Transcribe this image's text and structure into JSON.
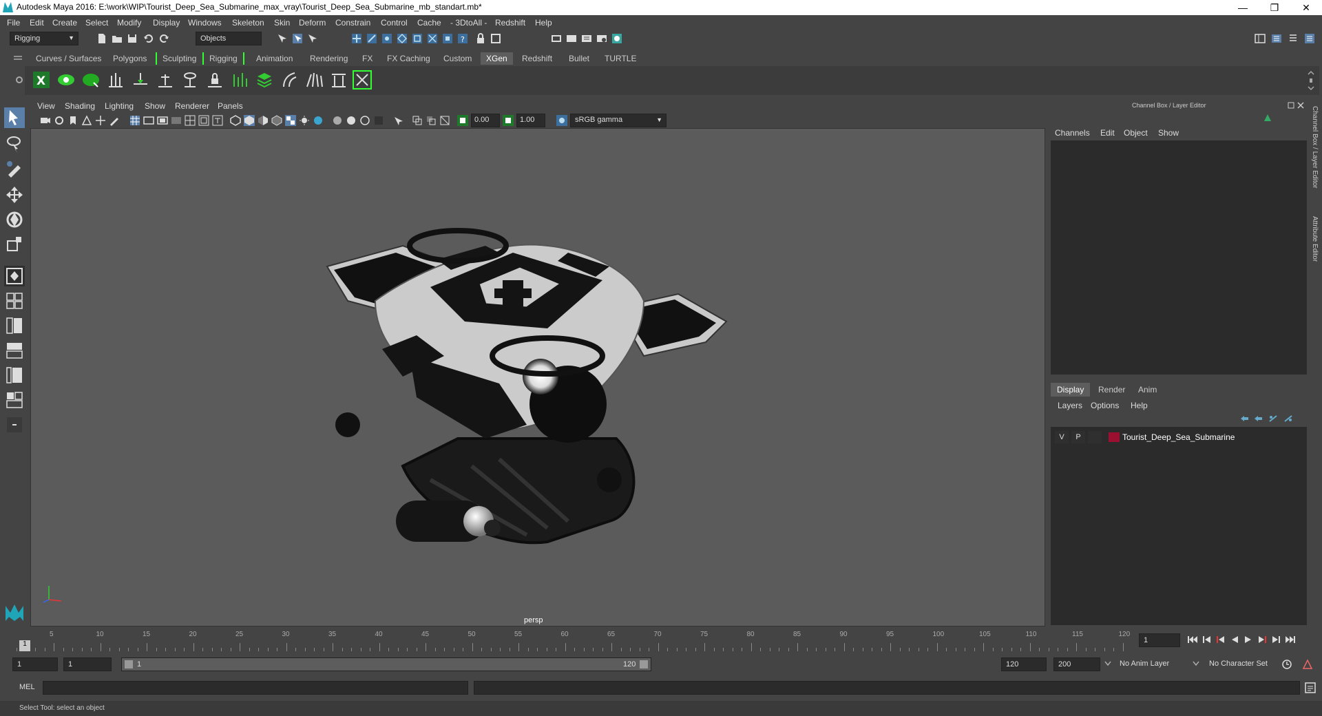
{
  "window": {
    "title": "Autodesk Maya 2016: E:\\work\\WIP\\Tourist_Deep_Sea_Submarine_max_vray\\Tourist_Deep_Sea_Submarine_mb_standart.mb*",
    "minimize": "—",
    "restore": "❐",
    "close": "✕"
  },
  "menubar": [
    "File",
    "Edit",
    "Create",
    "Select",
    "Modify",
    "Display",
    "Windows",
    "Skeleton",
    "Skin",
    "Deform",
    "Constrain",
    "Control",
    "Cache",
    "- 3DtoAll -",
    "Redshift",
    "Help"
  ],
  "toolbar": {
    "mode": "Rigging",
    "selection_mask": "Objects"
  },
  "shelf_tabs": {
    "items": [
      "Curves / Surfaces",
      "Polygons",
      "Sculpting",
      "Rigging",
      "Animation",
      "Rendering",
      "FX",
      "FX Caching",
      "Custom",
      "XGen",
      "Redshift",
      "Bullet",
      "TURTLE"
    ],
    "active": "XGen"
  },
  "viewport": {
    "menu": [
      "View",
      "Shading",
      "Lighting",
      "Show",
      "Renderer",
      "Panels"
    ],
    "exposure": "0.00",
    "gamma": "1.00",
    "colorspace": "sRGB gamma",
    "camera": "persp"
  },
  "channel_box": {
    "title": "Channel Box / Layer Editor",
    "menu": [
      "Channels",
      "Edit",
      "Object",
      "Show"
    ]
  },
  "layer_editor": {
    "tabs": [
      "Display",
      "Render",
      "Anim"
    ],
    "active_tab": "Display",
    "menu": [
      "Layers",
      "Options",
      "Help"
    ],
    "layer": {
      "visible": "V",
      "playback": "P",
      "name": "Tourist_Deep_Sea_Submarine",
      "color": "#9b1030"
    }
  },
  "side_tabs": [
    "Channel Box / Layer Editor",
    "Attribute Editor"
  ],
  "timeline": {
    "ticks": [
      "5",
      "10",
      "15",
      "20",
      "25",
      "30",
      "35",
      "40",
      "45",
      "50",
      "55",
      "60",
      "65",
      "70",
      "75",
      "80",
      "85",
      "90",
      "95",
      "100",
      "105",
      "110",
      "115",
      "120"
    ],
    "current_frame": "1",
    "current_frame_field": "1"
  },
  "range": {
    "start": "1",
    "anim_start": "1",
    "slider_start": "1",
    "slider_end": "120",
    "anim_end": "120",
    "end": "200",
    "anim_layer": "No Anim Layer",
    "character_set": "No Character Set"
  },
  "command_line": {
    "label": "MEL"
  },
  "help_line": "Select Tool: select an object"
}
